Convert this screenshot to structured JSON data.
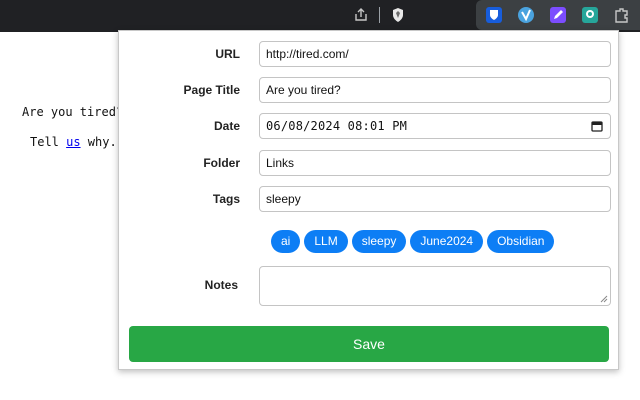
{
  "browser": {
    "toolbar_icons": [
      "share-icon",
      "brave-shield-icon"
    ],
    "extensions": [
      "bitwarden-icon",
      "extension-v-icon",
      "extension-pencil-icon",
      "extension-tag-icon",
      "puzzle-icon"
    ]
  },
  "page": {
    "question": "Are you tired?",
    "tell_prefix": "Tell ",
    "link_text": "us",
    "tell_suffix": " why."
  },
  "form": {
    "url_label": "URL",
    "url_value": "http://tired.com/",
    "title_label": "Page Title",
    "title_value": "Are you tired?",
    "date_label": "Date",
    "date_value": "06/08/2024 08:01 PM",
    "folder_label": "Folder",
    "folder_value": "Links",
    "tags_label": "Tags",
    "tags_value": "sleepy",
    "suggested_tags": [
      "ai",
      "LLM",
      "sleepy",
      "June2024",
      "Obsidian"
    ],
    "notes_label": "Notes",
    "notes_value": "",
    "save_label": "Save"
  },
  "colors": {
    "tag_bg": "#0d7ef5",
    "save_bg": "#28a745",
    "toolbar_bg": "#202124"
  }
}
